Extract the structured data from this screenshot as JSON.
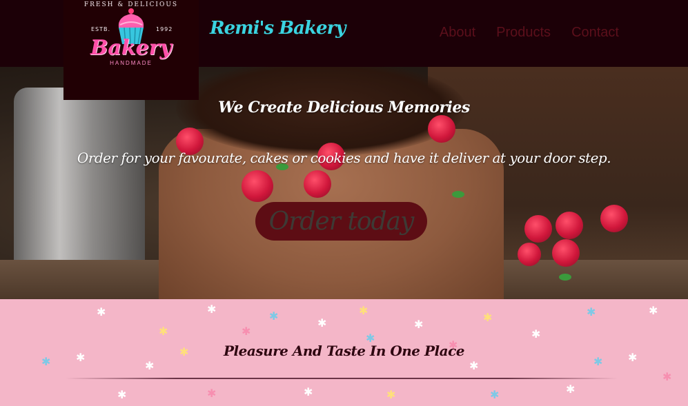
{
  "logo": {
    "arc_text": "FRESH & DELICIOUS",
    "estb": "ESTB.",
    "year": "1992",
    "word": "Bakery",
    "sub": "HANDMADE"
  },
  "brand": {
    "name": "Remi's Bakery",
    "color": "#3ad3e0"
  },
  "nav": {
    "links": [
      {
        "label": "About"
      },
      {
        "label": "Products"
      },
      {
        "label": "Contact"
      }
    ],
    "link_color": "#5b0f1b",
    "background": "#1c0007"
  },
  "hero": {
    "title": "We Create Delicious Memories",
    "subtitle": "Order for your favourate, cakes or cookies and have it deliver at your door step.",
    "cta_label": "Order today",
    "cta_color": "#5d0d14"
  },
  "section": {
    "title": "Pleasure And Taste In One Place",
    "background": "#f4b6c8"
  }
}
